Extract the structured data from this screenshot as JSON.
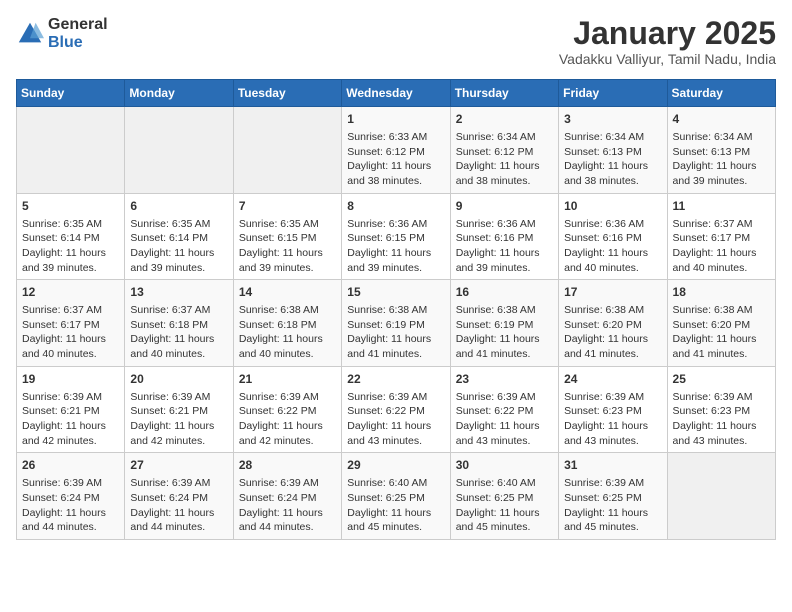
{
  "header": {
    "logo_general": "General",
    "logo_blue": "Blue",
    "month_title": "January 2025",
    "location": "Vadakku Valliyur, Tamil Nadu, India"
  },
  "days_of_week": [
    "Sunday",
    "Monday",
    "Tuesday",
    "Wednesday",
    "Thursday",
    "Friday",
    "Saturday"
  ],
  "weeks": [
    [
      {
        "day": "",
        "info": ""
      },
      {
        "day": "",
        "info": ""
      },
      {
        "day": "",
        "info": ""
      },
      {
        "day": "1",
        "info": "Sunrise: 6:33 AM\nSunset: 6:12 PM\nDaylight: 11 hours and 38 minutes."
      },
      {
        "day": "2",
        "info": "Sunrise: 6:34 AM\nSunset: 6:12 PM\nDaylight: 11 hours and 38 minutes."
      },
      {
        "day": "3",
        "info": "Sunrise: 6:34 AM\nSunset: 6:13 PM\nDaylight: 11 hours and 38 minutes."
      },
      {
        "day": "4",
        "info": "Sunrise: 6:34 AM\nSunset: 6:13 PM\nDaylight: 11 hours and 39 minutes."
      }
    ],
    [
      {
        "day": "5",
        "info": "Sunrise: 6:35 AM\nSunset: 6:14 PM\nDaylight: 11 hours and 39 minutes."
      },
      {
        "day": "6",
        "info": "Sunrise: 6:35 AM\nSunset: 6:14 PM\nDaylight: 11 hours and 39 minutes."
      },
      {
        "day": "7",
        "info": "Sunrise: 6:35 AM\nSunset: 6:15 PM\nDaylight: 11 hours and 39 minutes."
      },
      {
        "day": "8",
        "info": "Sunrise: 6:36 AM\nSunset: 6:15 PM\nDaylight: 11 hours and 39 minutes."
      },
      {
        "day": "9",
        "info": "Sunrise: 6:36 AM\nSunset: 6:16 PM\nDaylight: 11 hours and 39 minutes."
      },
      {
        "day": "10",
        "info": "Sunrise: 6:36 AM\nSunset: 6:16 PM\nDaylight: 11 hours and 40 minutes."
      },
      {
        "day": "11",
        "info": "Sunrise: 6:37 AM\nSunset: 6:17 PM\nDaylight: 11 hours and 40 minutes."
      }
    ],
    [
      {
        "day": "12",
        "info": "Sunrise: 6:37 AM\nSunset: 6:17 PM\nDaylight: 11 hours and 40 minutes."
      },
      {
        "day": "13",
        "info": "Sunrise: 6:37 AM\nSunset: 6:18 PM\nDaylight: 11 hours and 40 minutes."
      },
      {
        "day": "14",
        "info": "Sunrise: 6:38 AM\nSunset: 6:18 PM\nDaylight: 11 hours and 40 minutes."
      },
      {
        "day": "15",
        "info": "Sunrise: 6:38 AM\nSunset: 6:19 PM\nDaylight: 11 hours and 41 minutes."
      },
      {
        "day": "16",
        "info": "Sunrise: 6:38 AM\nSunset: 6:19 PM\nDaylight: 11 hours and 41 minutes."
      },
      {
        "day": "17",
        "info": "Sunrise: 6:38 AM\nSunset: 6:20 PM\nDaylight: 11 hours and 41 minutes."
      },
      {
        "day": "18",
        "info": "Sunrise: 6:38 AM\nSunset: 6:20 PM\nDaylight: 11 hours and 41 minutes."
      }
    ],
    [
      {
        "day": "19",
        "info": "Sunrise: 6:39 AM\nSunset: 6:21 PM\nDaylight: 11 hours and 42 minutes."
      },
      {
        "day": "20",
        "info": "Sunrise: 6:39 AM\nSunset: 6:21 PM\nDaylight: 11 hours and 42 minutes."
      },
      {
        "day": "21",
        "info": "Sunrise: 6:39 AM\nSunset: 6:22 PM\nDaylight: 11 hours and 42 minutes."
      },
      {
        "day": "22",
        "info": "Sunrise: 6:39 AM\nSunset: 6:22 PM\nDaylight: 11 hours and 43 minutes."
      },
      {
        "day": "23",
        "info": "Sunrise: 6:39 AM\nSunset: 6:22 PM\nDaylight: 11 hours and 43 minutes."
      },
      {
        "day": "24",
        "info": "Sunrise: 6:39 AM\nSunset: 6:23 PM\nDaylight: 11 hours and 43 minutes."
      },
      {
        "day": "25",
        "info": "Sunrise: 6:39 AM\nSunset: 6:23 PM\nDaylight: 11 hours and 43 minutes."
      }
    ],
    [
      {
        "day": "26",
        "info": "Sunrise: 6:39 AM\nSunset: 6:24 PM\nDaylight: 11 hours and 44 minutes."
      },
      {
        "day": "27",
        "info": "Sunrise: 6:39 AM\nSunset: 6:24 PM\nDaylight: 11 hours and 44 minutes."
      },
      {
        "day": "28",
        "info": "Sunrise: 6:39 AM\nSunset: 6:24 PM\nDaylight: 11 hours and 44 minutes."
      },
      {
        "day": "29",
        "info": "Sunrise: 6:40 AM\nSunset: 6:25 PM\nDaylight: 11 hours and 45 minutes."
      },
      {
        "day": "30",
        "info": "Sunrise: 6:40 AM\nSunset: 6:25 PM\nDaylight: 11 hours and 45 minutes."
      },
      {
        "day": "31",
        "info": "Sunrise: 6:39 AM\nSunset: 6:25 PM\nDaylight: 11 hours and 45 minutes."
      },
      {
        "day": "",
        "info": ""
      }
    ]
  ]
}
